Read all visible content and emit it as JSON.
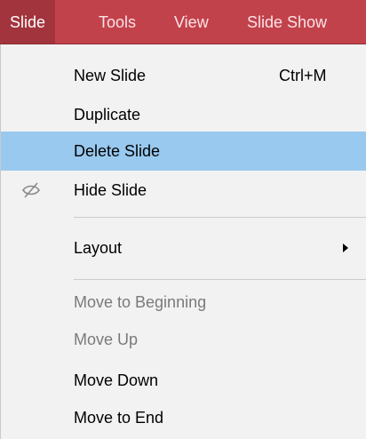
{
  "menubar": {
    "items": [
      {
        "label": "Slide"
      },
      {
        "label": "Tools"
      },
      {
        "label": "View"
      },
      {
        "label": "Slide Show"
      }
    ]
  },
  "dropdown": {
    "items": [
      {
        "label": "New Slide",
        "shortcut": "Ctrl+M",
        "state": "enabled"
      },
      {
        "label": "Duplicate",
        "state": "enabled"
      },
      {
        "label": "Delete Slide",
        "state": "highlighted"
      },
      {
        "label": "Hide Slide",
        "icon": "eye-slash-icon",
        "state": "enabled"
      },
      {
        "label": "Layout",
        "submenu": true,
        "state": "enabled"
      },
      {
        "label": "Move to Beginning",
        "state": "disabled"
      },
      {
        "label": "Move Up",
        "state": "disabled"
      },
      {
        "label": "Move Down",
        "state": "enabled"
      },
      {
        "label": "Move to End",
        "state": "enabled"
      }
    ]
  },
  "colors": {
    "menubar": "#c2424c",
    "menubar_active": "#a2343d",
    "dropdown_bg": "#f2f2f2",
    "highlight": "#99c9ef",
    "disabled_text": "#7a7a7a"
  }
}
